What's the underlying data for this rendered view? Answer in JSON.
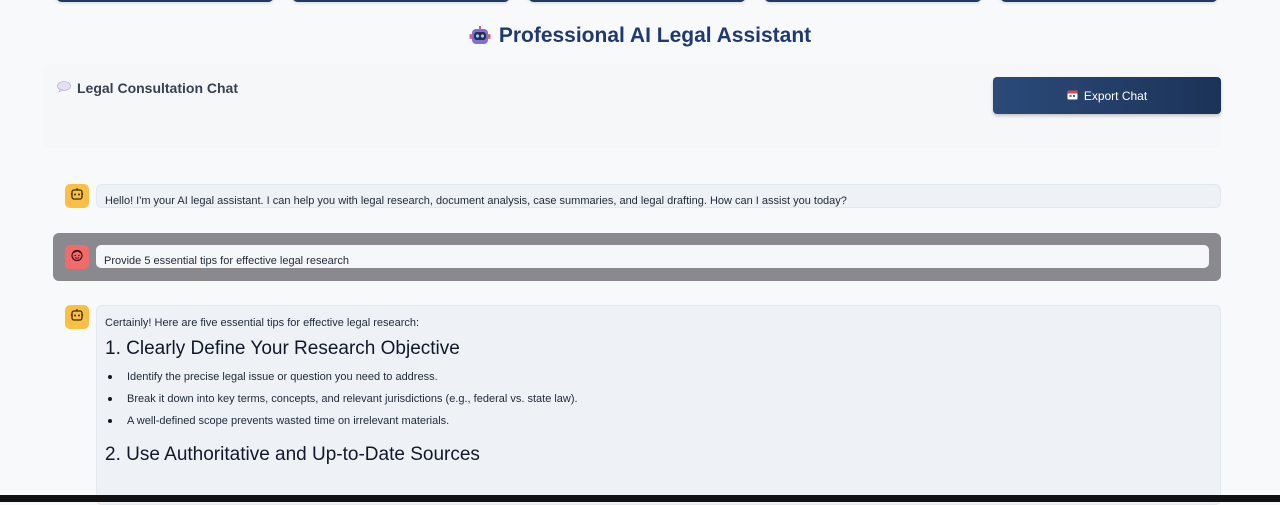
{
  "header": {
    "title": "Professional AI Legal Assistant",
    "title_icon": "robot-icon"
  },
  "chat_panel": {
    "title": "Legal Consultation Chat",
    "title_icon": "speech-balloon-icon",
    "export_label": "Export Chat",
    "export_icon": "calendar-icon"
  },
  "messages": [
    {
      "role": "assistant",
      "avatar_icon": "robot-face-icon",
      "text": "Hello! I'm your AI legal assistant. I can help you with legal research, document analysis, case summaries, and legal drafting. How can I assist you today?"
    },
    {
      "role": "user",
      "avatar_icon": "smiling-face-icon",
      "text": "Provide 5 essential tips for effective legal research"
    },
    {
      "role": "assistant",
      "avatar_icon": "robot-face-icon",
      "intro": "Certainly! Here are five essential tips for effective legal research:",
      "sections": [
        {
          "heading": "1. Clearly Define Your Research Objective",
          "bullets": [
            "Identify the precise legal issue or question you need to address.",
            "Break it down into key terms, concepts, and relevant jurisdictions (e.g., federal vs. state law).",
            "A well-defined scope prevents wasted time on irrelevant materials."
          ]
        },
        {
          "heading": "2. Use Authoritative and Up-to-Date Sources"
        }
      ]
    }
  ],
  "colors": {
    "background": "#f8f9fb",
    "title": "#1e3a6e",
    "export_button": "#1e3a5f",
    "bot_avatar": "#fbbf45",
    "user_avatar": "#f26b6b",
    "user_row": "#8a8a8e"
  }
}
